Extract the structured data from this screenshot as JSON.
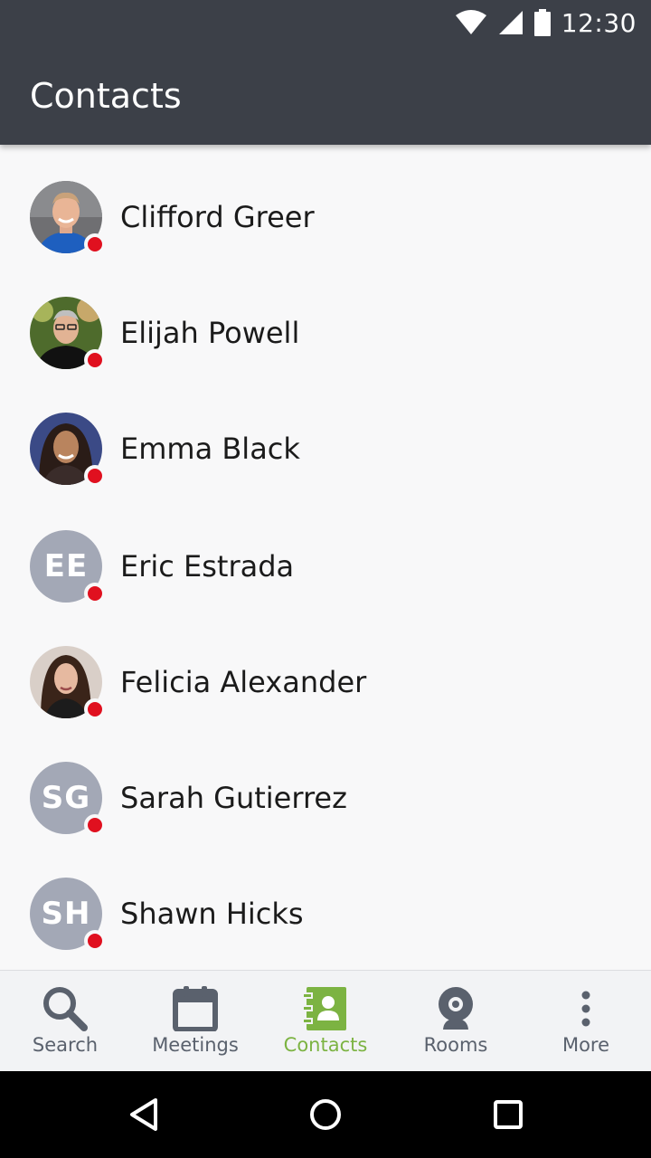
{
  "status_bar": {
    "time": "12:30",
    "icons": [
      "wifi-icon",
      "cell-signal-icon",
      "battery-icon"
    ]
  },
  "app_bar": {
    "title": "Contacts"
  },
  "contacts": [
    {
      "name": "Clifford Greer",
      "avatar": "photo",
      "presence": "busy"
    },
    {
      "name": "Elijah Powell",
      "avatar": "photo",
      "presence": "busy"
    },
    {
      "name": "Emma Black",
      "avatar": "photo",
      "presence": "busy"
    },
    {
      "name": "Eric Estrada",
      "avatar": "initials",
      "initials": "EE",
      "presence": "busy"
    },
    {
      "name": "Felicia Alexander",
      "avatar": "photo",
      "presence": "busy"
    },
    {
      "name": "Sarah Gutierrez",
      "avatar": "initials",
      "initials": "SG",
      "presence": "busy"
    },
    {
      "name": "Shawn Hicks",
      "avatar": "initials",
      "initials": "SH",
      "presence": "busy"
    }
  ],
  "bottom_nav": {
    "items": [
      {
        "label": "Search",
        "icon": "search-icon"
      },
      {
        "label": "Meetings",
        "icon": "calendar-icon"
      },
      {
        "label": "Contacts",
        "icon": "contacts-book-icon",
        "active": true
      },
      {
        "label": "Rooms",
        "icon": "webcam-icon"
      },
      {
        "label": "More",
        "icon": "more-vertical-icon"
      }
    ]
  },
  "system_nav": {
    "icons": [
      "back-icon",
      "home-icon",
      "recents-icon"
    ]
  },
  "colors": {
    "app_bar": "#3c4048",
    "accent": "#7cb342",
    "presence_busy": "#e0101f",
    "initials_avatar": "#a3a8b6"
  }
}
